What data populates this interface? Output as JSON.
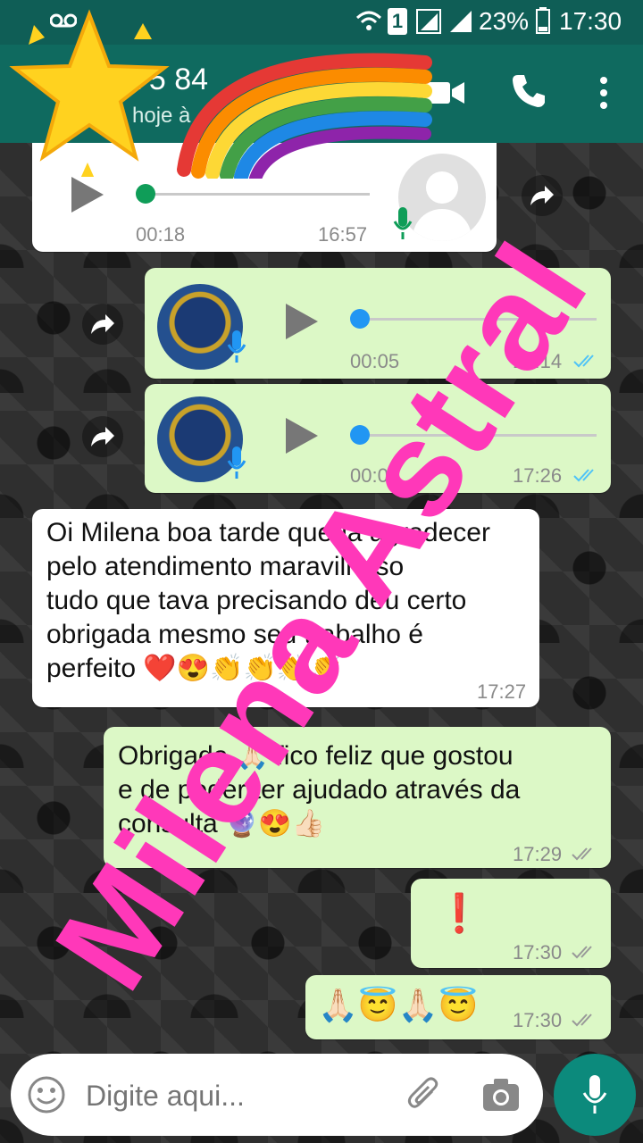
{
  "status_bar": {
    "battery": "23%",
    "time": "17:30",
    "sim": "1"
  },
  "header": {
    "contact": "75 84 ",
    "last_seen": "hoje à"
  },
  "messages": [
    {
      "type": "audio-in",
      "duration": "00:18",
      "time": "16:57"
    },
    {
      "type": "audio-out",
      "duration": "00:05",
      "time": "17:14"
    },
    {
      "type": "audio-out",
      "duration": "00:06",
      "time": "17:26"
    },
    {
      "type": "text-in",
      "text": "Oi Milena boa tarde queria agradecer\npelo atendimento maravilhoso\ntudo que tava precisando deu certo\nobrigada mesmo seu trabalho é\nperfeito ❤️😍👏👏👏👏",
      "time": "17:27"
    },
    {
      "type": "text-out",
      "text": "Obrigada 🙏🏻 fico feliz que gostou\ne de poder ter ajudado através da\nconsulta 🔮😍👍🏻",
      "time": "17:29"
    },
    {
      "type": "text-out",
      "text": "❗",
      "time": "17:30"
    },
    {
      "type": "text-out",
      "text": "🙏🏻😇🙏🏻😇",
      "time": "17:30"
    }
  ],
  "input": {
    "placeholder": "Digite aqui..."
  },
  "overlay": {
    "watermark": "Milena Astral"
  },
  "colors": {
    "header": "#0f6a5f",
    "outgoing": "#dcf8c6",
    "incoming": "#ffffff",
    "watermark": "#ff38b9",
    "tick_read": "#4fc3f7",
    "fab": "#0c8a7c"
  },
  "icons": [
    "voicemail-icon",
    "wifi-icon",
    "signal-icon",
    "battery-icon",
    "video-call-icon",
    "phone-icon",
    "more-icon",
    "play-icon",
    "mic-icon",
    "forward-icon",
    "emoji-icon",
    "attach-icon",
    "camera-icon",
    "star-sticker-icon",
    "rainbow-sticker-icon"
  ]
}
